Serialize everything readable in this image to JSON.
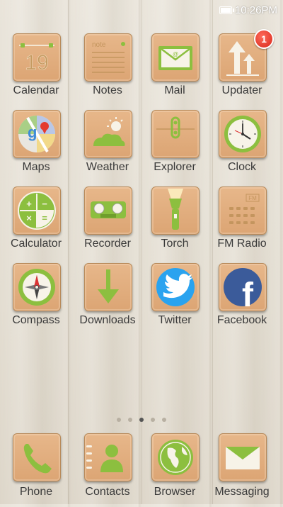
{
  "status_bar": {
    "time": "10:26PM",
    "battery_level": 0.9
  },
  "apps": [
    {
      "name": "calendar",
      "label": "Calendar",
      "date": "19"
    },
    {
      "name": "notes",
      "label": "Notes",
      "note_text": "note"
    },
    {
      "name": "mail",
      "label": "Mail",
      "mail_sign": "@"
    },
    {
      "name": "updater",
      "label": "Updater",
      "badge": "1"
    },
    {
      "name": "maps",
      "label": "Maps"
    },
    {
      "name": "weather",
      "label": "Weather"
    },
    {
      "name": "explorer",
      "label": "Explorer"
    },
    {
      "name": "clock",
      "label": "Clock"
    },
    {
      "name": "calculator",
      "label": "Calculator",
      "symbols": [
        "+",
        "−",
        "×",
        "="
      ]
    },
    {
      "name": "recorder",
      "label": "Recorder"
    },
    {
      "name": "torch",
      "label": "Torch"
    },
    {
      "name": "fm-radio",
      "label": "FM Radio",
      "band": "FM"
    },
    {
      "name": "compass",
      "label": "Compass"
    },
    {
      "name": "downloads",
      "label": "Downloads"
    },
    {
      "name": "twitter",
      "label": "Twitter"
    },
    {
      "name": "facebook",
      "label": "Facebook",
      "glyph": "f"
    }
  ],
  "pager": {
    "count": 5,
    "active_index": 2
  },
  "dock": [
    {
      "name": "phone",
      "label": "Phone"
    },
    {
      "name": "contacts",
      "label": "Contacts"
    },
    {
      "name": "browser",
      "label": "Browser"
    },
    {
      "name": "messaging",
      "label": "Messaging"
    }
  ],
  "colors": {
    "accent_green": "#8cbf3f",
    "tile": "#dca574",
    "badge": "#d8281c"
  }
}
